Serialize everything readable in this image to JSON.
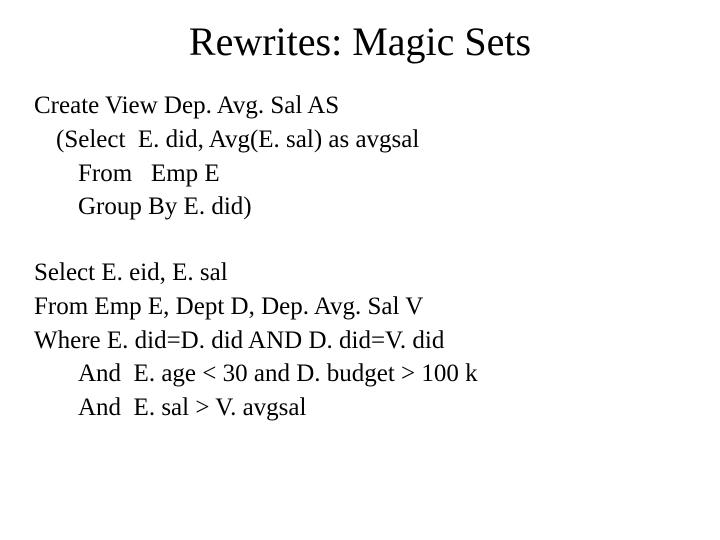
{
  "title": "Rewrites: Magic Sets",
  "block1": {
    "l1": "Create View Dep. Avg. Sal AS",
    "l2": "(Select  E. did, Avg(E. sal) as avgsal",
    "l3": "From   Emp E",
    "l4": "Group By E. did)"
  },
  "block2": {
    "l1": "Select E. eid, E. sal",
    "l2": "From Emp E, Dept D, Dep. Avg. Sal V",
    "l3": "Where E. did=D. did AND D. did=V. did",
    "l4": "And  E. age < 30 and D. budget > 100 k",
    "l5": "And  E. sal > V. avgsal"
  }
}
